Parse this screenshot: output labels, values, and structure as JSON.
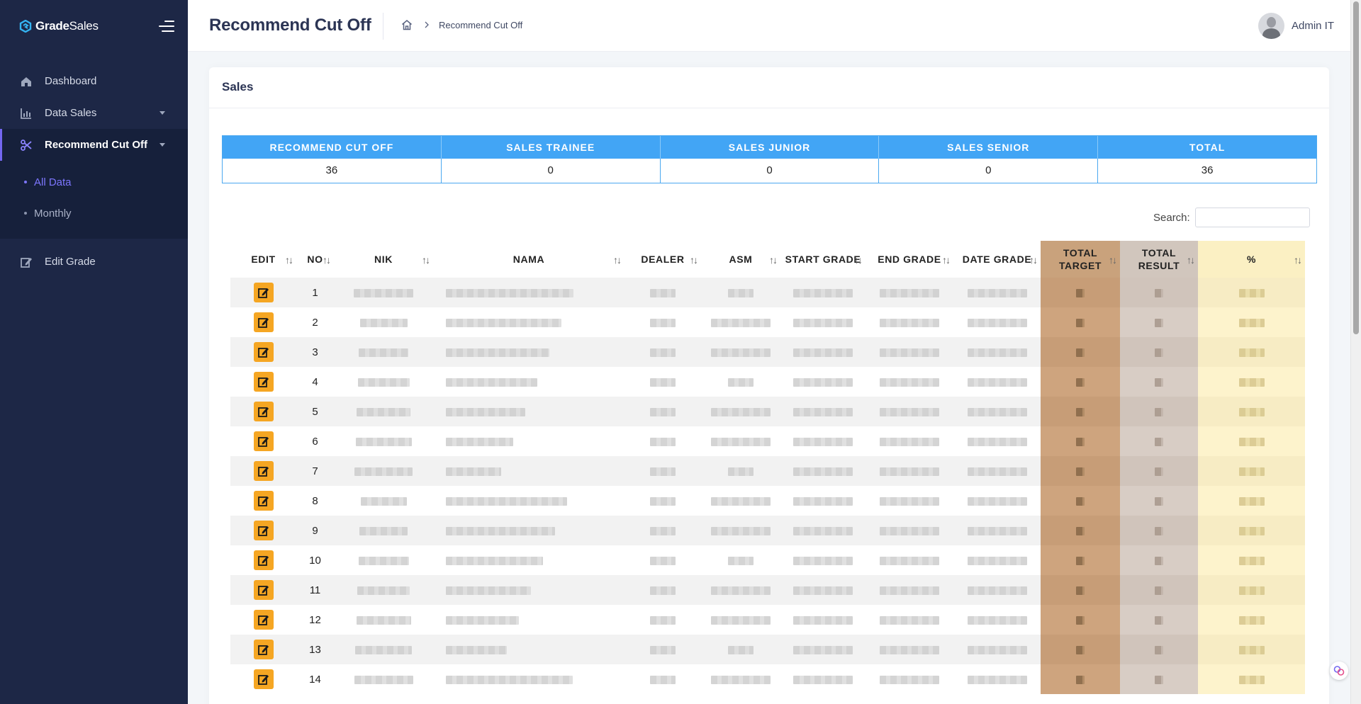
{
  "brand": {
    "part1": "Grade",
    "part2": "Sales"
  },
  "sidebar": {
    "items": [
      {
        "label": "Dashboard",
        "icon": "home-icon"
      },
      {
        "label": "Data Sales",
        "icon": "bar-chart-icon"
      },
      {
        "label": "Recommend Cut Off",
        "icon": "scissors-icon"
      }
    ],
    "subitems": [
      {
        "label": "All Data"
      },
      {
        "label": "Monthly"
      }
    ],
    "lower": {
      "label": "Edit Grade",
      "icon": "edit-icon"
    }
  },
  "header": {
    "title": "Recommend Cut Off",
    "breadcrumb": "Recommend Cut Off",
    "user": "Admin IT"
  },
  "card": {
    "title": "Sales",
    "search_label": "Search:",
    "search_value": ""
  },
  "summary": {
    "headers": [
      "RECOMMEND CUT OFF",
      "SALES TRAINEE",
      "SALES JUNIOR",
      "SALES SENIOR",
      "TOTAL"
    ],
    "values": [
      "36",
      "0",
      "0",
      "0",
      "36"
    ]
  },
  "table": {
    "columns": {
      "edit": "EDIT",
      "no": "NO",
      "nik": "NIK",
      "nama": "NAMA",
      "dealer": "DEALER",
      "asm": "ASM",
      "start": "START GRADE",
      "end": "END GRADE",
      "date": "DATE GRADE",
      "target1": "TOTAL",
      "target2": "TARGET",
      "result1": "TOTAL",
      "result2": "RESULT",
      "pct": "%"
    },
    "sort_glyph": "↑↓",
    "rows": [
      "1",
      "2",
      "3",
      "4",
      "5",
      "6",
      "7",
      "8",
      "9",
      "10",
      "11",
      "12",
      "13",
      "14"
    ]
  },
  "colors": {
    "sidebar_bg": "#1d2746",
    "accent": "#7367f0",
    "summary_header": "#42a5f5",
    "edit_button": "#f5a623",
    "total_target_col": "#c9a27c",
    "total_result_col": "#d1c6bd",
    "percent_col": "#fbf0c3"
  }
}
